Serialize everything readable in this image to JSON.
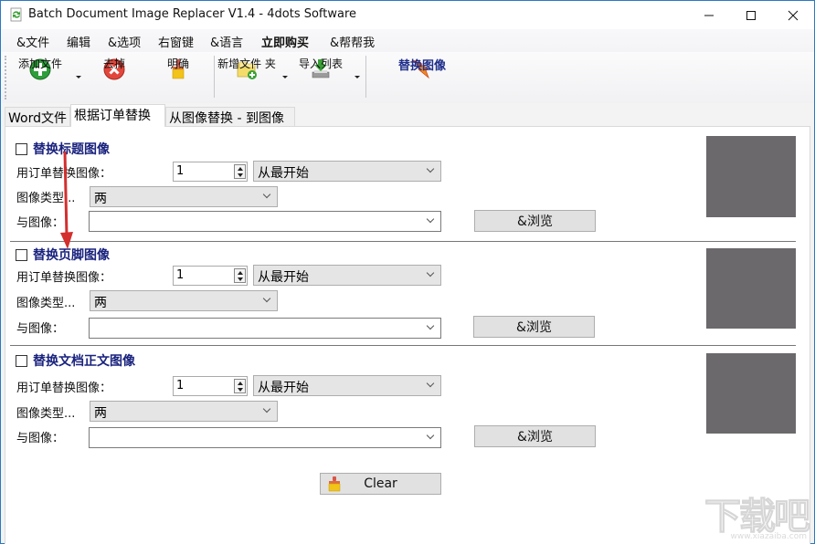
{
  "window": {
    "title": "Batch Document Image Replacer V1.4 - 4dots Software",
    "icon": "app-recycle-document-icon",
    "controls": [
      "minimize-icon",
      "maximize-icon",
      "close-icon"
    ]
  },
  "menu": {
    "items": [
      {
        "label": "&文件",
        "bold": false
      },
      {
        "label": "编辑",
        "bold": false
      },
      {
        "label": "&选项",
        "bold": false
      },
      {
        "label": "右窗键",
        "bold": false
      },
      {
        "label": "&语言",
        "bold": false
      },
      {
        "label": "立即购买",
        "bold": true
      },
      {
        "label": "&帮帮我",
        "bold": false
      }
    ]
  },
  "toolbar": {
    "add_files": {
      "label": "添加文件",
      "icon": "plus-circle-icon",
      "has_dropdown": true
    },
    "remove": {
      "label": "去掉",
      "icon": "x-circle-icon"
    },
    "clear": {
      "label": "明确",
      "icon": "brush-icon"
    },
    "add_folder": {
      "label": "新增文件 夹",
      "icon": "folder-add-icon",
      "has_dropdown": true
    },
    "import_list": {
      "label": "导入列表",
      "icon": "import-icon",
      "has_dropdown": true
    },
    "replace_images": {
      "label": "替换图像",
      "icon": "lightning-icon",
      "accent": "#1f2e8a"
    }
  },
  "tabs": [
    {
      "label": "Word文件",
      "active": false
    },
    {
      "label": "根据订单替换",
      "active": true
    },
    {
      "label": "从图像替换 - 到图像",
      "active": false
    }
  ],
  "sections": [
    {
      "title": "替换标题图像",
      "checked": false,
      "order_label": "用订单替换图像：",
      "order_value": "1",
      "from_value": "从最开始",
      "type_label": "图像类型...",
      "type_value": "两",
      "with_label": "与图像：",
      "with_value": "",
      "browse_label": "&浏览"
    },
    {
      "title": "替换页脚图像",
      "checked": false,
      "order_label": "用订单替换图像：",
      "order_value": "1",
      "from_value": "从最开始",
      "type_label": "图像类型...",
      "type_value": "两",
      "with_label": "与图像：",
      "with_value": "",
      "browse_label": "&浏览"
    },
    {
      "title": "替换文档正文图像",
      "checked": false,
      "order_label": "用订单替换图像：",
      "order_value": "1",
      "from_value": "从最开始",
      "type_label": "图像类型...",
      "type_value": "两",
      "with_label": "与图像：",
      "with_value": "",
      "browse_label": "&浏览"
    }
  ],
  "clear_button": {
    "label": "Clear",
    "icon": "brush-icon"
  },
  "watermark": {
    "text": "下载吧",
    "sub": "www.xiazaiba.com"
  },
  "colors": {
    "section_title": "#1a237e",
    "preview": "#6b696b",
    "annotation_arrow": "#d32f2f",
    "window_border": "#2b79c2"
  }
}
